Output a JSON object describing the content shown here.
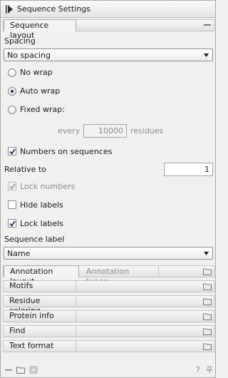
{
  "panel": {
    "title": "Sequence Settings"
  },
  "sequence_layout": {
    "tab_label": "Sequence layout",
    "spacing_label": "Spacing",
    "spacing_value": "No spacing",
    "wrap_options": [
      "No wrap",
      "Auto wrap",
      "Fixed wrap:"
    ],
    "wrap_selected": "Auto wrap",
    "every_label": "every",
    "every_value": "10000",
    "residues_label": "residues",
    "numbers_on_sequences_label": "Numbers on sequences",
    "numbers_on_sequences_checked": true,
    "relative_to_label": "Relative to",
    "relative_to_value": "1",
    "lock_numbers_label": "Lock numbers",
    "lock_numbers_checked": true,
    "hide_labels_label": "Hide labels",
    "hide_labels_checked": false,
    "lock_labels_label": "Lock labels",
    "lock_labels_checked": true,
    "sequence_label_label": "Sequence label",
    "sequence_label_value": "Name"
  },
  "sections": {
    "annotation_layout": "Annotation layout",
    "annotation_types": "Annotation types",
    "motifs": "Motifs",
    "residue_coloring": "Residue coloring",
    "protein_info": "Protein info",
    "find": "Find",
    "text_format": "Text format"
  },
  "bottom_bar": {
    "help": "?"
  },
  "colors": {
    "background": "#f0f0f0",
    "border": "#a9a9a9",
    "radio_dot": "#1e2f5a"
  }
}
